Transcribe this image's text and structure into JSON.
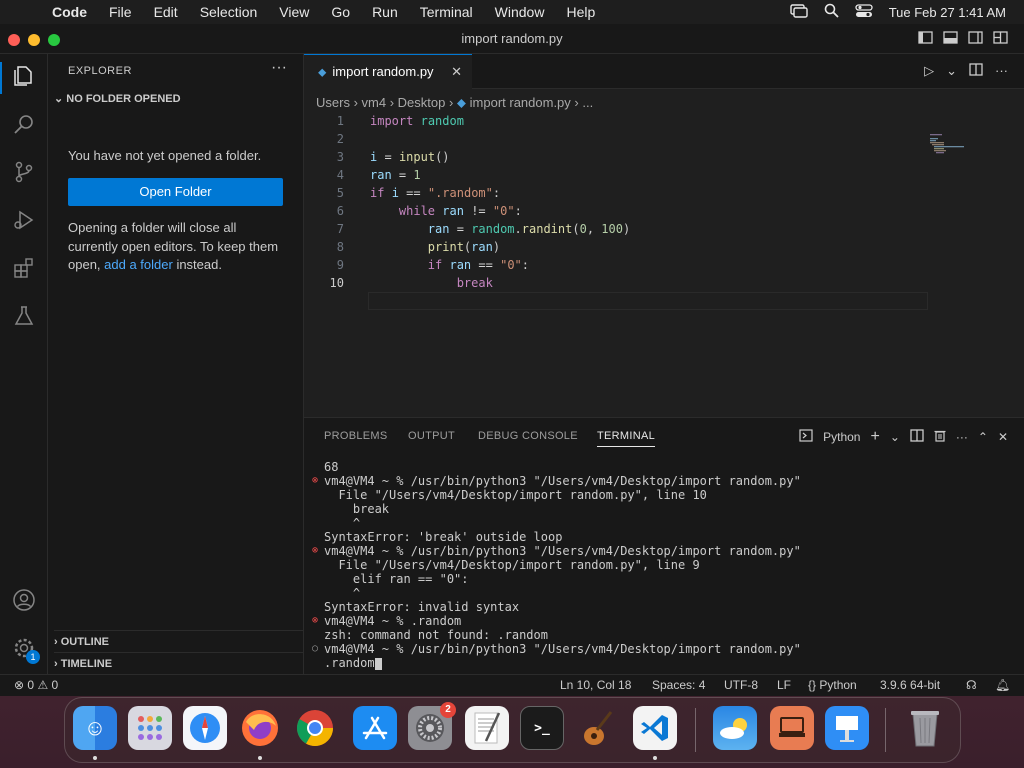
{
  "menubar": {
    "app": "Code",
    "items": [
      "File",
      "Edit",
      "Selection",
      "View",
      "Go",
      "Run",
      "Terminal",
      "Window",
      "Help"
    ],
    "clock": "Tue Feb 27  1:41 AM"
  },
  "window": {
    "title": "import random.py"
  },
  "sidebar": {
    "title": "EXPLORER",
    "section": "NO FOLDER OPENED",
    "message": "You have not yet opened a folder.",
    "open_folder": "Open Folder",
    "note_part1": "Opening a folder will close all currently open editors. To keep them open, ",
    "note_link": "add a folder",
    "note_part2": " instead.",
    "outline": "OUTLINE",
    "timeline": "TIMELINE"
  },
  "editor": {
    "tab_label": "import random.py",
    "breadcrumb": [
      "Users",
      "vm4",
      "Desktop",
      "import random.py",
      "..."
    ],
    "line_numbers": [
      "1",
      "2",
      "3",
      "4",
      "5",
      "6",
      "7",
      "8",
      "9",
      "10"
    ]
  },
  "panel": {
    "tabs": [
      "PROBLEMS",
      "OUTPUT",
      "DEBUG CONSOLE",
      "TERMINAL"
    ],
    "shell_label": "Python",
    "terminal_lines": [
      {
        "text": "68",
        "mark": ""
      },
      {
        "text": "vm4@VM4 ~ % /usr/bin/python3 \"/Users/vm4/Desktop/import random.py\"",
        "mark": "err"
      },
      {
        "text": "  File \"/Users/vm4/Desktop/import random.py\", line 10",
        "mark": ""
      },
      {
        "text": "    break",
        "mark": ""
      },
      {
        "text": "    ^",
        "mark": ""
      },
      {
        "text": "SyntaxError: 'break' outside loop",
        "mark": ""
      },
      {
        "text": "vm4@VM4 ~ % /usr/bin/python3 \"/Users/vm4/Desktop/import random.py\"",
        "mark": "err"
      },
      {
        "text": "  File \"/Users/vm4/Desktop/import random.py\", line 9",
        "mark": ""
      },
      {
        "text": "    elif ran == \"0\":",
        "mark": ""
      },
      {
        "text": "    ^",
        "mark": ""
      },
      {
        "text": "SyntaxError: invalid syntax",
        "mark": ""
      },
      {
        "text": "vm4@VM4 ~ % .random",
        "mark": "err"
      },
      {
        "text": "zsh: command not found: .random",
        "mark": ""
      },
      {
        "text": "vm4@VM4 ~ % /usr/bin/python3 \"/Users/vm4/Desktop/import random.py\"",
        "mark": "neu"
      },
      {
        "text": ".random",
        "mark": ""
      }
    ]
  },
  "status": {
    "errors": "0",
    "warnings": "0",
    "position": "Ln 10, Col 18",
    "spaces": "Spaces: 4",
    "encoding": "UTF-8",
    "eol": "LF",
    "language": "Python",
    "interpreter": "3.9.6 64-bit"
  },
  "dock": {
    "settings_badge": "2",
    "accounts_badge": "1"
  }
}
